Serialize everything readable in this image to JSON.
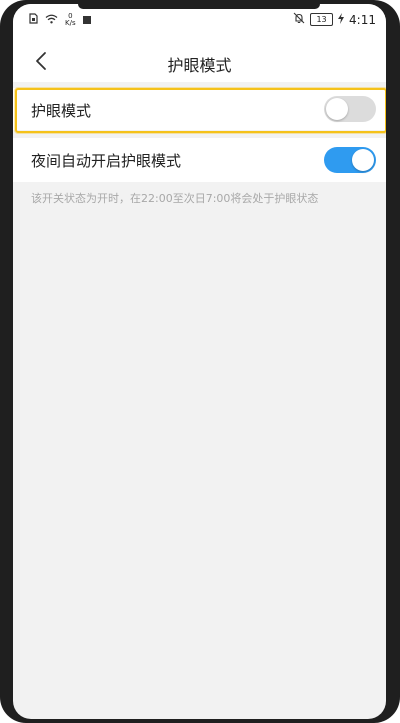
{
  "status_bar": {
    "network_rate_value": "0",
    "network_rate_unit": "K/s",
    "battery_level": "13",
    "time": "4:11"
  },
  "header": {
    "title": "护眼模式"
  },
  "settings": [
    {
      "label": "护眼模式",
      "enabled": false
    },
    {
      "label": "夜间自动开启护眼模式",
      "enabled": true
    }
  ],
  "note": "该开关状态为开时，在22:00至次日7:00将会处于护眼状态",
  "colors": {
    "toggle_on": "#2f9bf0",
    "toggle_off": "#dcdcdc",
    "highlight": "#f5c21a"
  },
  "icons": [
    "sim-card-icon",
    "wifi-icon",
    "notification-square-icon",
    "bell-off-icon",
    "battery-icon",
    "charging-icon",
    "back-arrow-icon"
  ]
}
